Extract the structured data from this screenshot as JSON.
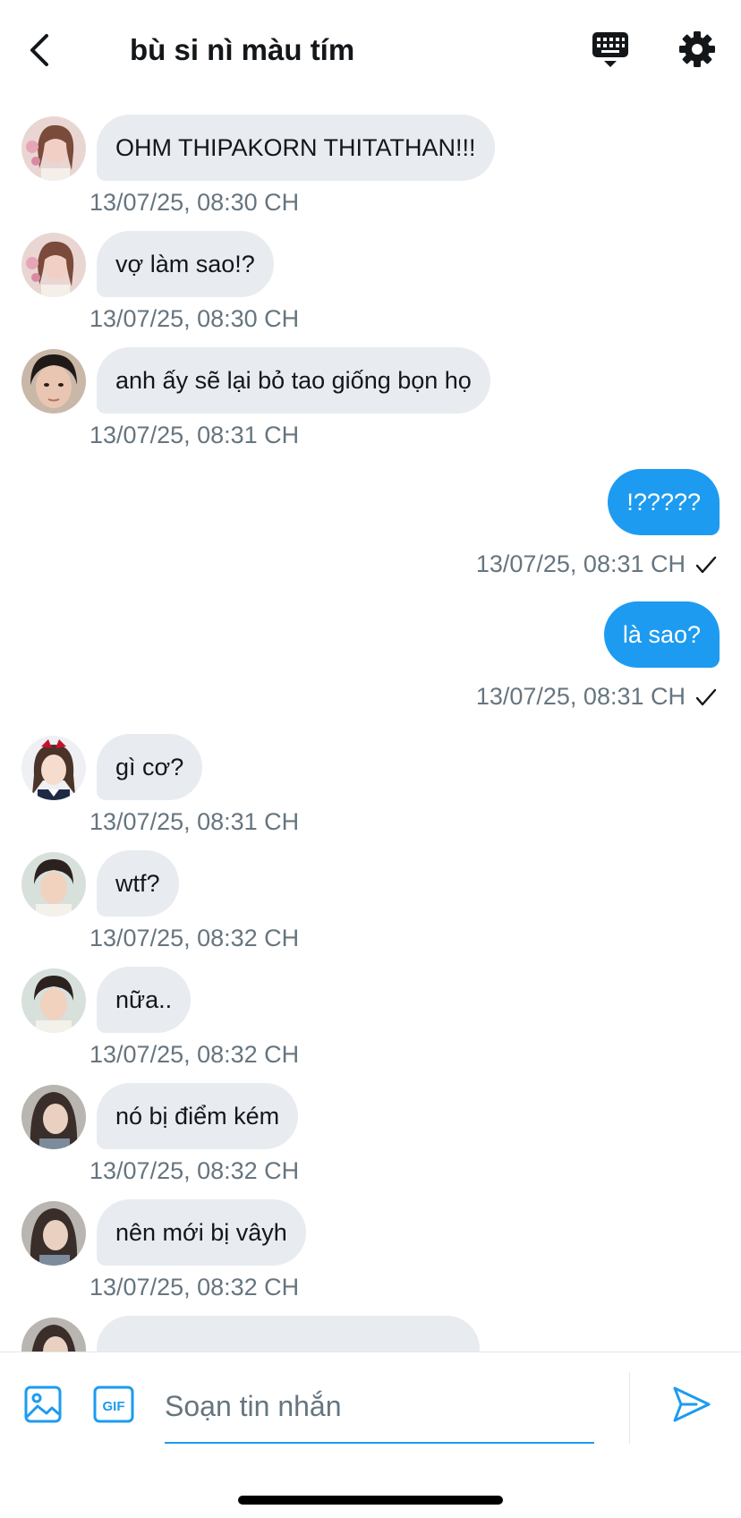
{
  "header": {
    "title": "bù si nì màu tím"
  },
  "icons": {
    "back": "chevron-left-icon",
    "keyboard": "keyboard-icon",
    "settings": "gear-icon",
    "image": "image-icon",
    "gif": "gif-icon",
    "send": "send-icon",
    "read": "checkmark-icon"
  },
  "colors": {
    "accent": "#1d9bf0",
    "incoming_bubble": "#e8ebef",
    "timestamp": "#66757f"
  },
  "messages": [
    {
      "direction": "in",
      "sender": "avatar-a",
      "text": "OHM THIPAKORN THITATHAN!!!",
      "time": "13/07/25, 08:30 CH"
    },
    {
      "direction": "in",
      "sender": "avatar-a",
      "text": "vợ làm sao!?",
      "time": "13/07/25, 08:30 CH"
    },
    {
      "direction": "in",
      "sender": "avatar-b",
      "text": "anh ấy sẽ lại bỏ tao giống bọn họ",
      "time": "13/07/25, 08:31 CH"
    },
    {
      "direction": "out",
      "text": "!?????",
      "time": "13/07/25, 08:31 CH"
    },
    {
      "direction": "out",
      "text": "là sao?",
      "time": "13/07/25, 08:31 CH"
    },
    {
      "direction": "in",
      "sender": "avatar-c",
      "text": "gì cơ?",
      "time": "13/07/25, 08:31 CH"
    },
    {
      "direction": "in",
      "sender": "avatar-d",
      "text": "wtf?",
      "time": "13/07/25, 08:32 CH"
    },
    {
      "direction": "in",
      "sender": "avatar-d",
      "text": "nữa..",
      "time": "13/07/25, 08:32 CH"
    },
    {
      "direction": "in",
      "sender": "avatar-e",
      "text": "nó bị điểm kém",
      "time": "13/07/25, 08:32 CH"
    },
    {
      "direction": "in",
      "sender": "avatar-e",
      "text": "nên mới bị vâyh",
      "time": "13/07/25, 08:32 CH"
    }
  ],
  "composer": {
    "placeholder": "Soạn tin nhắn",
    "gif_label": "GIF"
  }
}
